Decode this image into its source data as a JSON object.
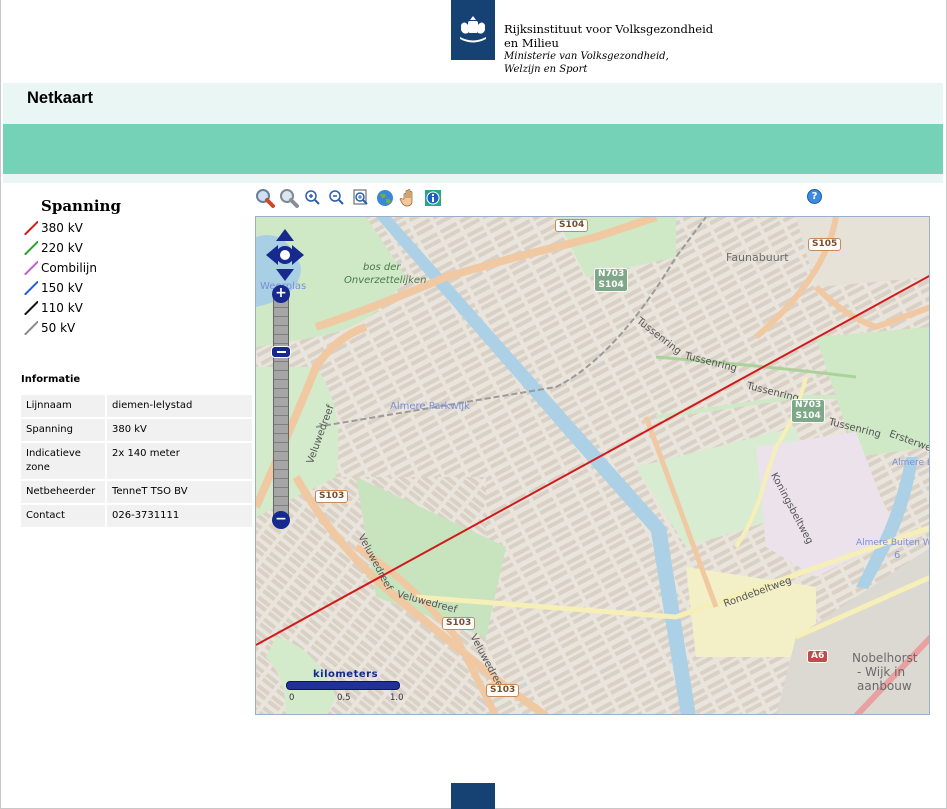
{
  "header": {
    "org_line1": "Rijksinstituut voor Volksgezondheid",
    "org_line2": "en Milieu",
    "org_line3": "Ministerie van Volksgezondheid,",
    "org_line4": "Welzijn en Sport"
  },
  "page_title": "Netkaart",
  "legend": {
    "title": "Spanning",
    "items": [
      {
        "label": "380 kV",
        "color": "#d11a1a"
      },
      {
        "label": "220 kV",
        "color": "#28a428"
      },
      {
        "label": "Combilijn",
        "color": "#c85ad8"
      },
      {
        "label": "150 kV",
        "color": "#1f5fd8"
      },
      {
        "label": "110 kV",
        "color": "#111111"
      },
      {
        "label": "50 kV",
        "color": "#8a8a8a"
      }
    ]
  },
  "info": {
    "title": "Informatie",
    "rows": [
      {
        "key": "Lijnnaam",
        "value": "diemen-lelystad"
      },
      {
        "key": "Spanning",
        "value": "380 kV"
      },
      {
        "key": "Indicatieve zone",
        "value": "2x 140 meter"
      },
      {
        "key": "Netbeheerder",
        "value": "TenneT TSO BV"
      },
      {
        "key": "Contact",
        "value": "026-3731111"
      }
    ]
  },
  "toolbar": {
    "tools": [
      "zoom-in-box-icon",
      "zoom-out-box-icon",
      "zoom-in-icon",
      "zoom-out-icon",
      "zoom-extent-icon",
      "globe-icon",
      "pan-hand-icon",
      "info-icon"
    ],
    "help_label": "?"
  },
  "map": {
    "places": {
      "faunabuurt": "Faunabuurt",
      "bos": "bos der",
      "bos2": "Onverzettelijken",
      "parkwijk": "Almere Parkwijk",
      "weerplas": "Weerplas",
      "nobelhorst1": "Nobelhorst",
      "nobelhorst2": "- Wijk in",
      "nobelhorst3": "aanbouw",
      "almere_buiten": "Almere Buiten",
      "almere_buiten_w": "Almere Buiten W",
      "six": "6"
    },
    "streets": {
      "tussenring1": "Tussenring",
      "tussenring2": "Tussenring",
      "tussenring3": "Tussenring",
      "tussenring4": "Tussenring",
      "veluwedreef1": "Veluwedreef",
      "veluwedreef2": "Veluwedreef",
      "veluwedreef3": "Veluwedreef",
      "veluwedreef4": "Veluwedreef",
      "koningsbeltweg": "Koningsbeltweg",
      "rondebeltweg": "Rondebeltweg",
      "ersterweg": "Ersterweg"
    },
    "shields": {
      "s104a": "S104",
      "s105": "S105",
      "n703a": "N703",
      "s104b": "S104",
      "n703b": "N703",
      "s104c": "S104",
      "s103a": "S103",
      "s103b": "S103",
      "s103c": "S103",
      "a6": "A6"
    },
    "zoom_plus": "+",
    "zoom_minus": "−",
    "scale": {
      "label": "kilometers",
      "ticks": [
        "0",
        "0.5",
        "1.0"
      ]
    }
  }
}
